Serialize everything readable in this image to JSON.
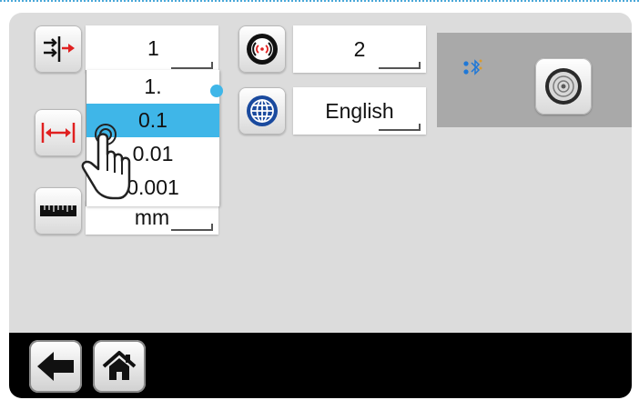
{
  "settings": {
    "direction_value": "",
    "resolution_options": [
      "1.",
      "0.1",
      "0.01",
      "0.001"
    ],
    "resolution_selected_index": 1,
    "unit_value": "mm",
    "sensor_value": "2",
    "language_value": "English"
  },
  "icons": {
    "direction": "direction-arrows-icon",
    "resolution": "measure-span-icon",
    "unit": "ruler-icon",
    "sensor": "wireless-sensor-icon",
    "language": "globe-icon",
    "bluetooth": "bluetooth-icon",
    "disc": "disc-icon",
    "back": "back-arrow-icon",
    "home": "home-icon",
    "pointer": "hand-pointer-icon"
  },
  "colors": {
    "accent": "#3fb6e8",
    "arrow_red": "#e02020",
    "screen_bg": "#dcdcdc",
    "bar_bg": "#000000"
  }
}
